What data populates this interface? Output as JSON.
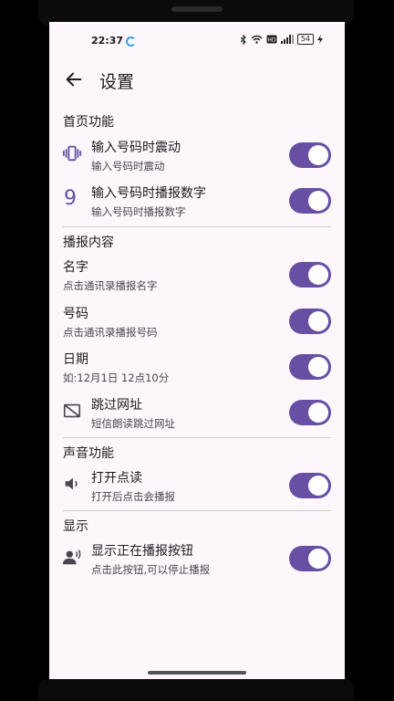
{
  "status": {
    "time": "22:37",
    "battery": "54"
  },
  "appbar": {
    "title": "设置",
    "back_icon": "arrow-left-icon"
  },
  "colors": {
    "accent": "#6750a4",
    "background": "#fdf7fc",
    "knob": "#ffffff"
  },
  "sections": [
    {
      "header": "首页功能",
      "items": [
        {
          "icon": "vibrate-icon",
          "primary": "输入号码时震动",
          "secondary": "输入号码时震动",
          "enabled": true
        },
        {
          "icon": "nine-digit-icon",
          "icon_text": "9",
          "primary": "输入号码时播报数字",
          "secondary": "输入号码时播报数字",
          "enabled": true
        }
      ]
    },
    {
      "header": "播报内容",
      "items": [
        {
          "primary": "名字",
          "secondary": "点击通讯录播报名字",
          "enabled": true
        },
        {
          "primary": "号码",
          "secondary": "点击通讯录播报号码",
          "enabled": true
        },
        {
          "primary": "日期",
          "secondary": "如:12月1日 12点10分",
          "enabled": true
        },
        {
          "icon": "hide-link-icon",
          "primary": "跳过网址",
          "secondary": "短信朗读跳过网址",
          "enabled": true
        }
      ]
    },
    {
      "header": "声音功能",
      "items": [
        {
          "icon": "speaker-icon",
          "primary": "打开点读",
          "secondary": "打开后点击会播报",
          "enabled": true
        }
      ]
    },
    {
      "header": "显示",
      "items": [
        {
          "icon": "person-voice-icon",
          "primary": "显示正在播报按钮",
          "secondary": "点击此按钮,可以停止播报",
          "enabled": true
        }
      ]
    }
  ]
}
